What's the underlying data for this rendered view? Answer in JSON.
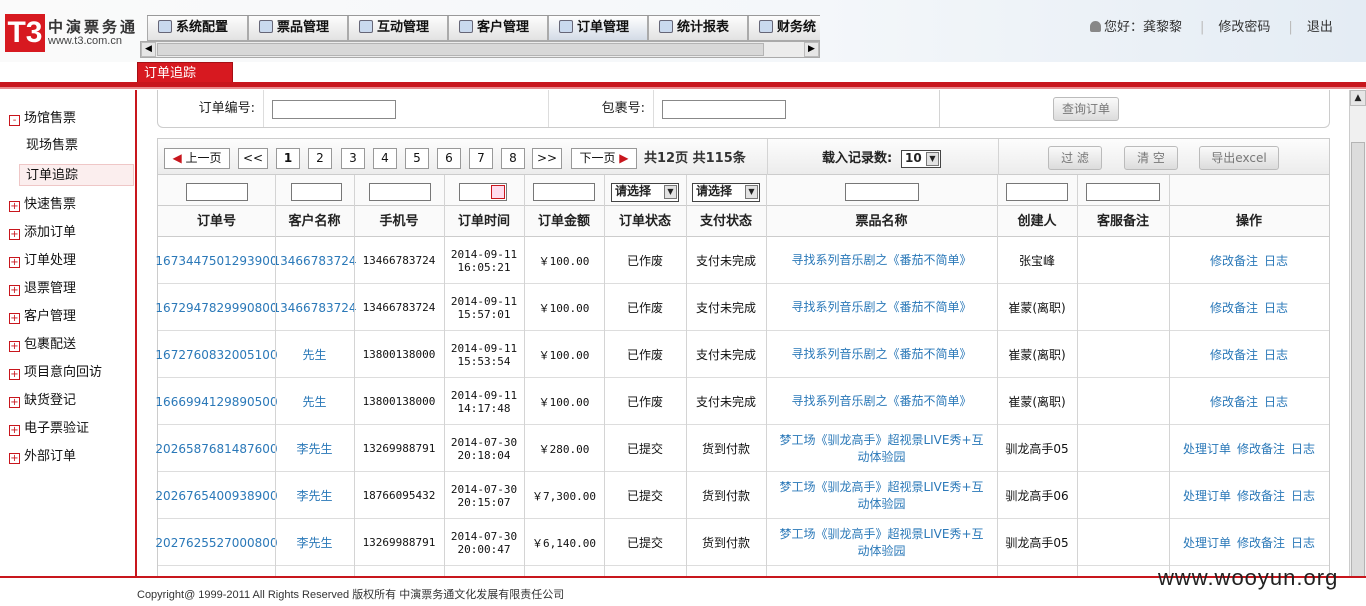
{
  "header": {
    "logo_mark": "T3",
    "logo_name": "中演票务通",
    "logo_url": "www.t3.com.cn",
    "menu": [
      {
        "label": "系统配置"
      },
      {
        "label": "票品管理"
      },
      {
        "label": "互动管理"
      },
      {
        "label": "客户管理"
      },
      {
        "label": "订单管理"
      },
      {
        "label": "统计报表"
      },
      {
        "label": "财务统"
      }
    ],
    "user_greeting": "您好：龚黎黎",
    "change_password": "修改密码",
    "logout": "退出"
  },
  "tab": {
    "label": "订单追踪"
  },
  "sidebar": {
    "items": [
      {
        "label": "场馆售票",
        "kind": "group"
      },
      {
        "label": "现场售票",
        "kind": "sub"
      },
      {
        "label": "订单追踪",
        "kind": "selected"
      },
      {
        "label": "快速售票",
        "kind": "group"
      },
      {
        "label": "添加订单",
        "kind": "group"
      },
      {
        "label": "订单处理",
        "kind": "group"
      },
      {
        "label": "退票管理",
        "kind": "group"
      },
      {
        "label": "客户管理",
        "kind": "group"
      },
      {
        "label": "包裹配送",
        "kind": "group"
      },
      {
        "label": "项目意向回访",
        "kind": "group"
      },
      {
        "label": "缺货登记",
        "kind": "group"
      },
      {
        "label": "电子票验证",
        "kind": "group"
      },
      {
        "label": "外部订单",
        "kind": "group"
      }
    ]
  },
  "search": {
    "order_no_label": "订单编号:",
    "order_no_value": "",
    "package_no_label": "包裹号:",
    "package_no_value": "",
    "query_button": "查询订单"
  },
  "pager": {
    "prev": "上一页",
    "first": "<<",
    "pages": [
      "1",
      "2",
      "3",
      "4",
      "5",
      "6",
      "7",
      "8"
    ],
    "current_page": "1",
    "last": ">>",
    "next": "下一页",
    "info": "共12页 共115条",
    "load_label": "载入记录数:",
    "load_value": "10",
    "filter_button": "过 滤",
    "clear_button": "清 空",
    "export_button": "导出excel"
  },
  "filters": {
    "order_status_select": "请选择",
    "pay_status_select": "请选择"
  },
  "table": {
    "columns": [
      "订单号",
      "客户名称",
      "手机号",
      "订单时间",
      "订单金额",
      "订单状态",
      "支付状态",
      "票品名称",
      "创建人",
      "客服备注",
      "操作"
    ],
    "rows": [
      {
        "order_no": "1673447501293900",
        "customer": "13466783724",
        "phone": "13466783724",
        "date": "2014-09-11",
        "time": "16:05:21",
        "amount": "￥100.00",
        "status": "已作废",
        "pay": "支付未完成",
        "product": "寻找系列音乐剧之《番茄不简单》",
        "creator": "张宝峰",
        "remark": "",
        "ops": [
          "修改备注",
          "日志"
        ]
      },
      {
        "order_no": "1672947829990800",
        "customer": "13466783724",
        "phone": "13466783724",
        "date": "2014-09-11",
        "time": "15:57:01",
        "amount": "￥100.00",
        "status": "已作废",
        "pay": "支付未完成",
        "product": "寻找系列音乐剧之《番茄不简单》",
        "creator": "崔蒙(离职)",
        "remark": "",
        "ops": [
          "修改备注",
          "日志"
        ]
      },
      {
        "order_no": "1672760832005100",
        "customer": "先生",
        "phone": "13800138000",
        "date": "2014-09-11",
        "time": "15:53:54",
        "amount": "￥100.00",
        "status": "已作废",
        "pay": "支付未完成",
        "product": "寻找系列音乐剧之《番茄不简单》",
        "creator": "崔蒙(离职)",
        "remark": "",
        "ops": [
          "修改备注",
          "日志"
        ]
      },
      {
        "order_no": "1666994129890500",
        "customer": "先生",
        "phone": "13800138000",
        "date": "2014-09-11",
        "time": "14:17:48",
        "amount": "￥100.00",
        "status": "已作废",
        "pay": "支付未完成",
        "product": "寻找系列音乐剧之《番茄不简单》",
        "creator": "崔蒙(离职)",
        "remark": "",
        "ops": [
          "修改备注",
          "日志"
        ]
      },
      {
        "order_no": "2026587681487600",
        "customer": "李先生",
        "phone": "13269988791",
        "date": "2014-07-30",
        "time": "20:18:04",
        "amount": "￥280.00",
        "status": "已提交",
        "pay": "货到付款",
        "product": "梦工场《驯龙高手》超视景LIVE秀+互动体验园",
        "creator": "驯龙高手05",
        "remark": "",
        "ops": [
          "处理订单",
          "修改备注",
          "日志"
        ]
      },
      {
        "order_no": "2026765400938900",
        "customer": "李先生",
        "phone": "18766095432",
        "date": "2014-07-30",
        "time": "20:15:07",
        "amount": "￥7,300.00",
        "status": "已提交",
        "pay": "货到付款",
        "product": "梦工场《驯龙高手》超视景LIVE秀+互动体验园",
        "creator": "驯龙高手06",
        "remark": "",
        "ops": [
          "处理订单",
          "修改备注",
          "日志"
        ]
      },
      {
        "order_no": "2027625527000800",
        "customer": "李先生",
        "phone": "13269988791",
        "date": "2014-07-30",
        "time": "20:00:47",
        "amount": "￥6,140.00",
        "status": "已提交",
        "pay": "货到付款",
        "product": "梦工场《驯龙高手》超视景LIVE秀+互动体验园",
        "creator": "驯龙高手05",
        "remark": "",
        "ops": [
          "处理订单",
          "修改备注",
          "日志"
        ]
      }
    ]
  },
  "footer": {
    "copyright": "Copyright@ 1999-2011 All Rights Reserved 版权所有 中演票务通文化发展有限责任公司",
    "watermark": "www.wooyun.org"
  },
  "colors": {
    "brand_red": "#c8161d",
    "link_blue": "#2a78b8"
  }
}
